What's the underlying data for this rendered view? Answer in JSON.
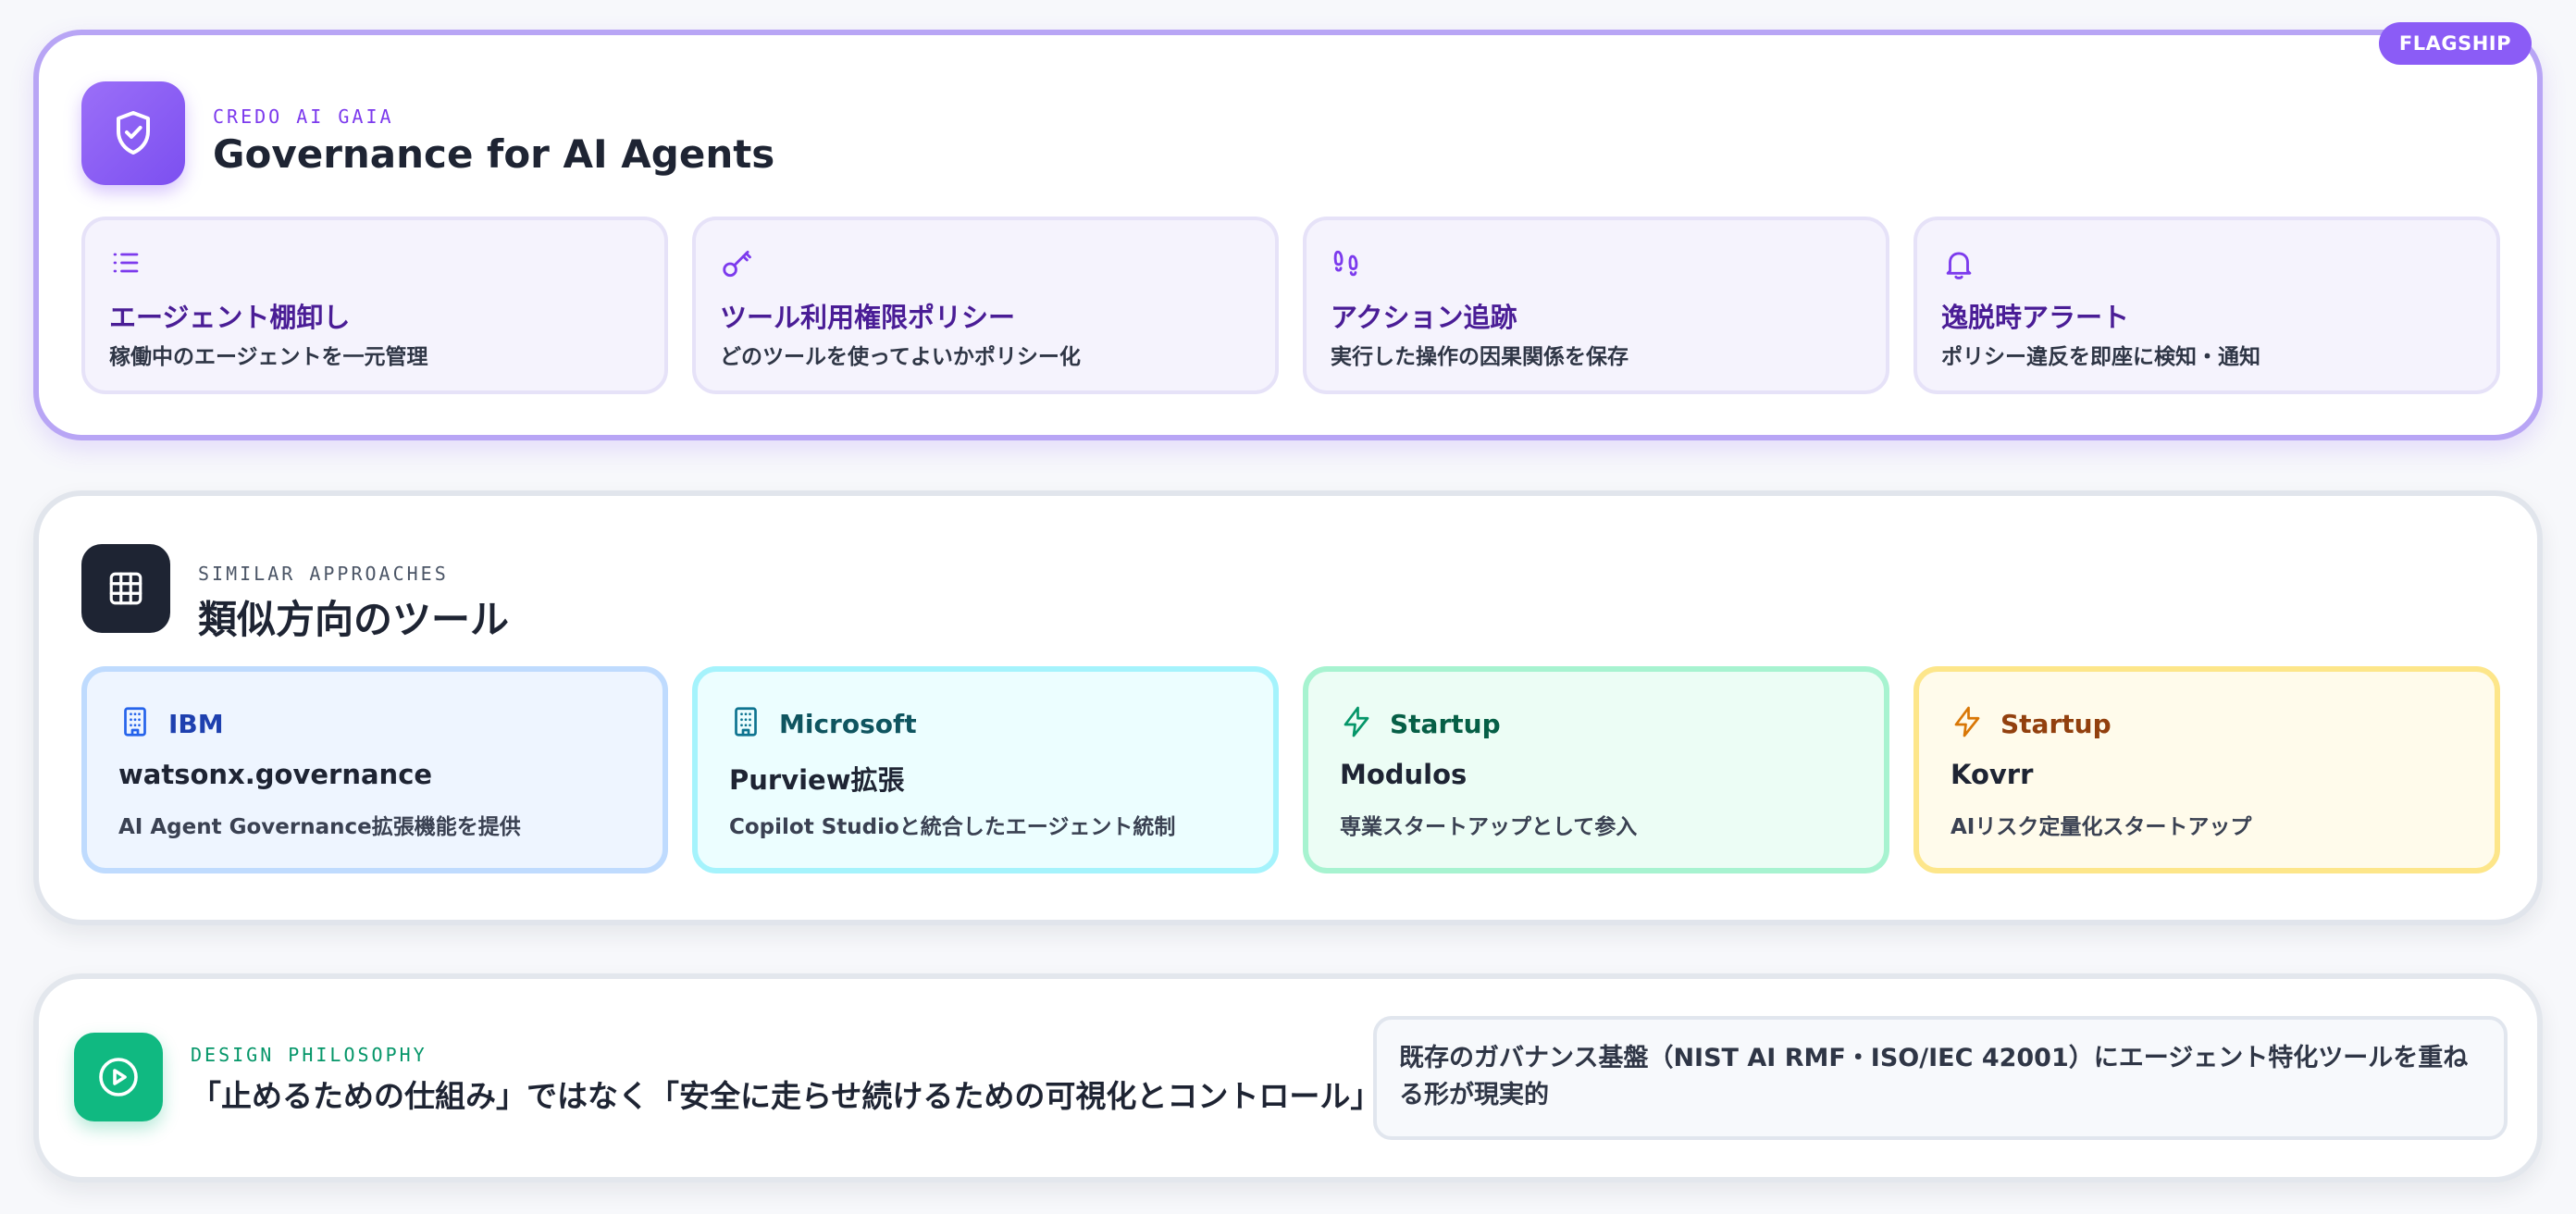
{
  "flagship": {
    "badge": "FLAGSHIP",
    "kicker": "CREDO AI GAIA",
    "title": "Governance for AI Agents",
    "icon": "shield-check-icon",
    "accent": "#8b5cf6",
    "features": [
      {
        "icon": "list-icon",
        "title": "エージェント棚卸し",
        "desc": "稼働中のエージェントを一元管理"
      },
      {
        "icon": "key-icon",
        "title": "ツール利用権限ポリシー",
        "desc": "どのツールを使ってよいかポリシー化"
      },
      {
        "icon": "footprints-icon",
        "title": "アクション追跡",
        "desc": "実行した操作の因果関係を保存"
      },
      {
        "icon": "bell-icon",
        "title": "逸脱時アラート",
        "desc": "ポリシー違反を即座に検知・通知"
      }
    ]
  },
  "similar": {
    "kicker": "SIMILAR APPROACHES",
    "title": "類似方向のツール",
    "icon": "grid-icon",
    "tools": [
      {
        "icon": "building-icon",
        "vendor": "IBM",
        "product": "watsonx.governance",
        "desc": "AI Agent Governance拡張機能を提供",
        "color": "#1e40af"
      },
      {
        "icon": "building-icon",
        "vendor": "Microsoft",
        "product": "Purview拡張",
        "desc": "Copilot Studioと統合したエージェント統制",
        "color": "#0f5560"
      },
      {
        "icon": "bolt-icon",
        "vendor": "Startup",
        "product": "Modulos",
        "desc": "専業スタートアップとして参入",
        "color": "#065f46"
      },
      {
        "icon": "bolt-icon",
        "vendor": "Startup",
        "product": "Kovrr",
        "desc": "AIリスク定量化スタートアップ",
        "color": "#92400e"
      }
    ]
  },
  "philosophy": {
    "kicker": "DESIGN PHILOSOPHY",
    "title": "「止めるための仕組み」ではなく「安全に走らせ続けるための可視化とコントロール」",
    "icon": "play-circle-icon",
    "note": "既存のガバナンス基盤（NIST AI RMF・ISO/IEC 42001）にエージェント特化ツールを重ねる形が現実的",
    "accent": "#10b981"
  }
}
